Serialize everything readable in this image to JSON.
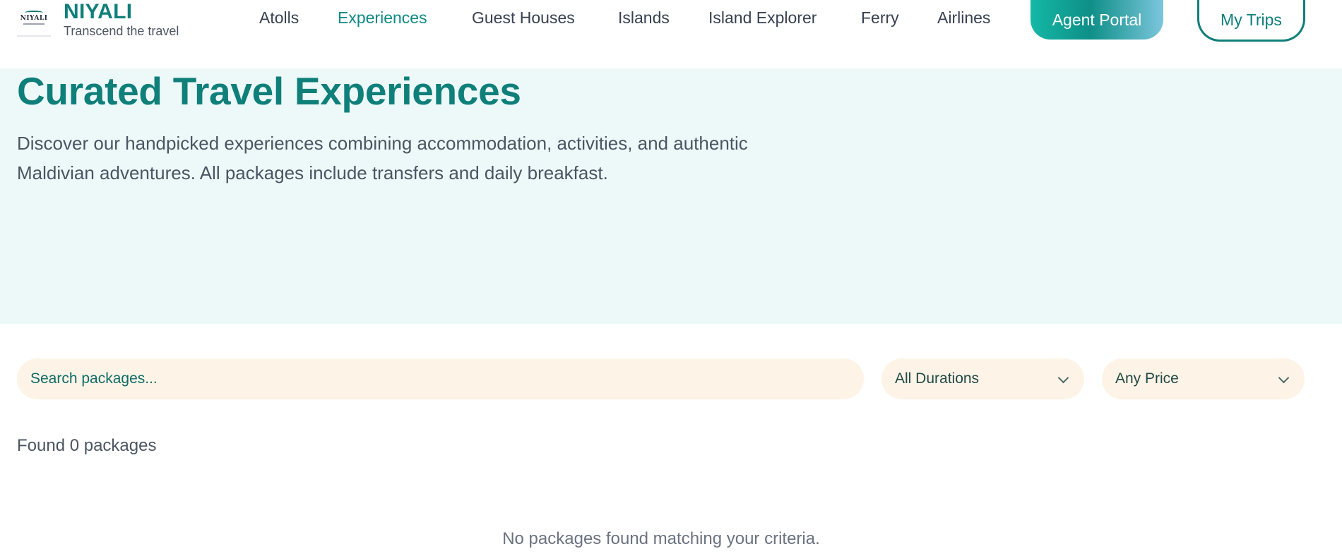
{
  "brand": {
    "logo_text": "NIYALI",
    "name": "NIYALI",
    "tagline": "Transcend the travel"
  },
  "nav": {
    "items": [
      {
        "label": "Atolls",
        "active": false
      },
      {
        "label": "Experiences",
        "active": true
      },
      {
        "label": "Guest Houses",
        "active": false
      },
      {
        "label": "Islands",
        "active": false
      },
      {
        "label": "Island Explorer",
        "active": false
      },
      {
        "label": "Ferry",
        "active": false
      },
      {
        "label": "Airlines",
        "active": false
      }
    ],
    "agent_portal_label": "Agent Portal",
    "my_trips_label": "My Trips"
  },
  "hero": {
    "title": "Curated Travel Experiences",
    "description": "Discover our handpicked experiences combining accommodation, activities, and authentic Maldivian adventures. All packages include transfers and daily breakfast."
  },
  "filters": {
    "search_placeholder": "Search packages...",
    "duration_selected": "All Durations",
    "price_selected": "Any Price"
  },
  "results": {
    "found_text": "Found 0 packages",
    "empty_text": "No packages found matching your criteria."
  },
  "colors": {
    "brand_teal": "#0f7f7a",
    "hero_bg": "#edf9f9",
    "filter_bg": "#fdf3e6"
  }
}
